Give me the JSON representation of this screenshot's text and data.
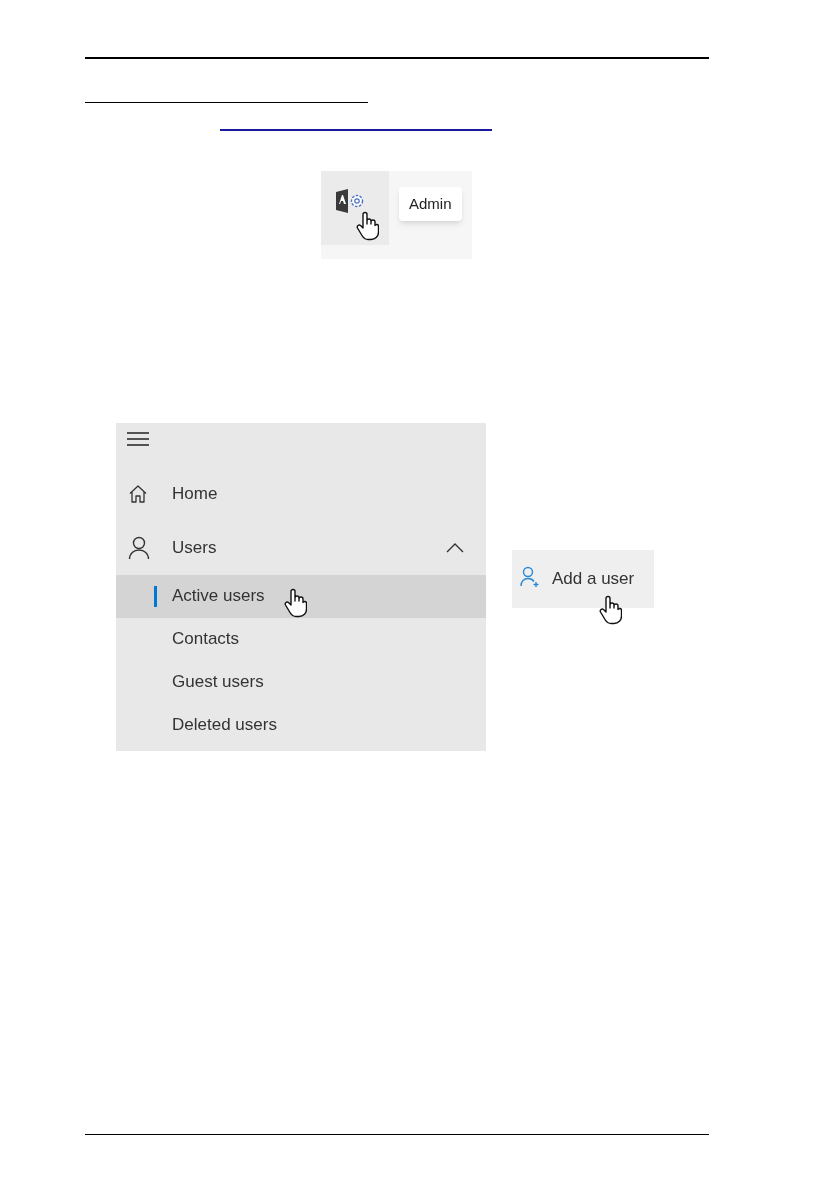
{
  "admin_tile": {
    "tooltip": "Admin"
  },
  "sidebar": {
    "items": [
      {
        "kind": "home",
        "label": "Home"
      },
      {
        "kind": "users",
        "label": "Users",
        "expanded": true,
        "children": [
          {
            "label": "Active users",
            "selected": true
          },
          {
            "label": "Contacts",
            "selected": false
          },
          {
            "label": "Guest users",
            "selected": false
          },
          {
            "label": "Deleted users",
            "selected": false
          }
        ]
      }
    ]
  },
  "add_user_button": {
    "label": "Add a user"
  }
}
